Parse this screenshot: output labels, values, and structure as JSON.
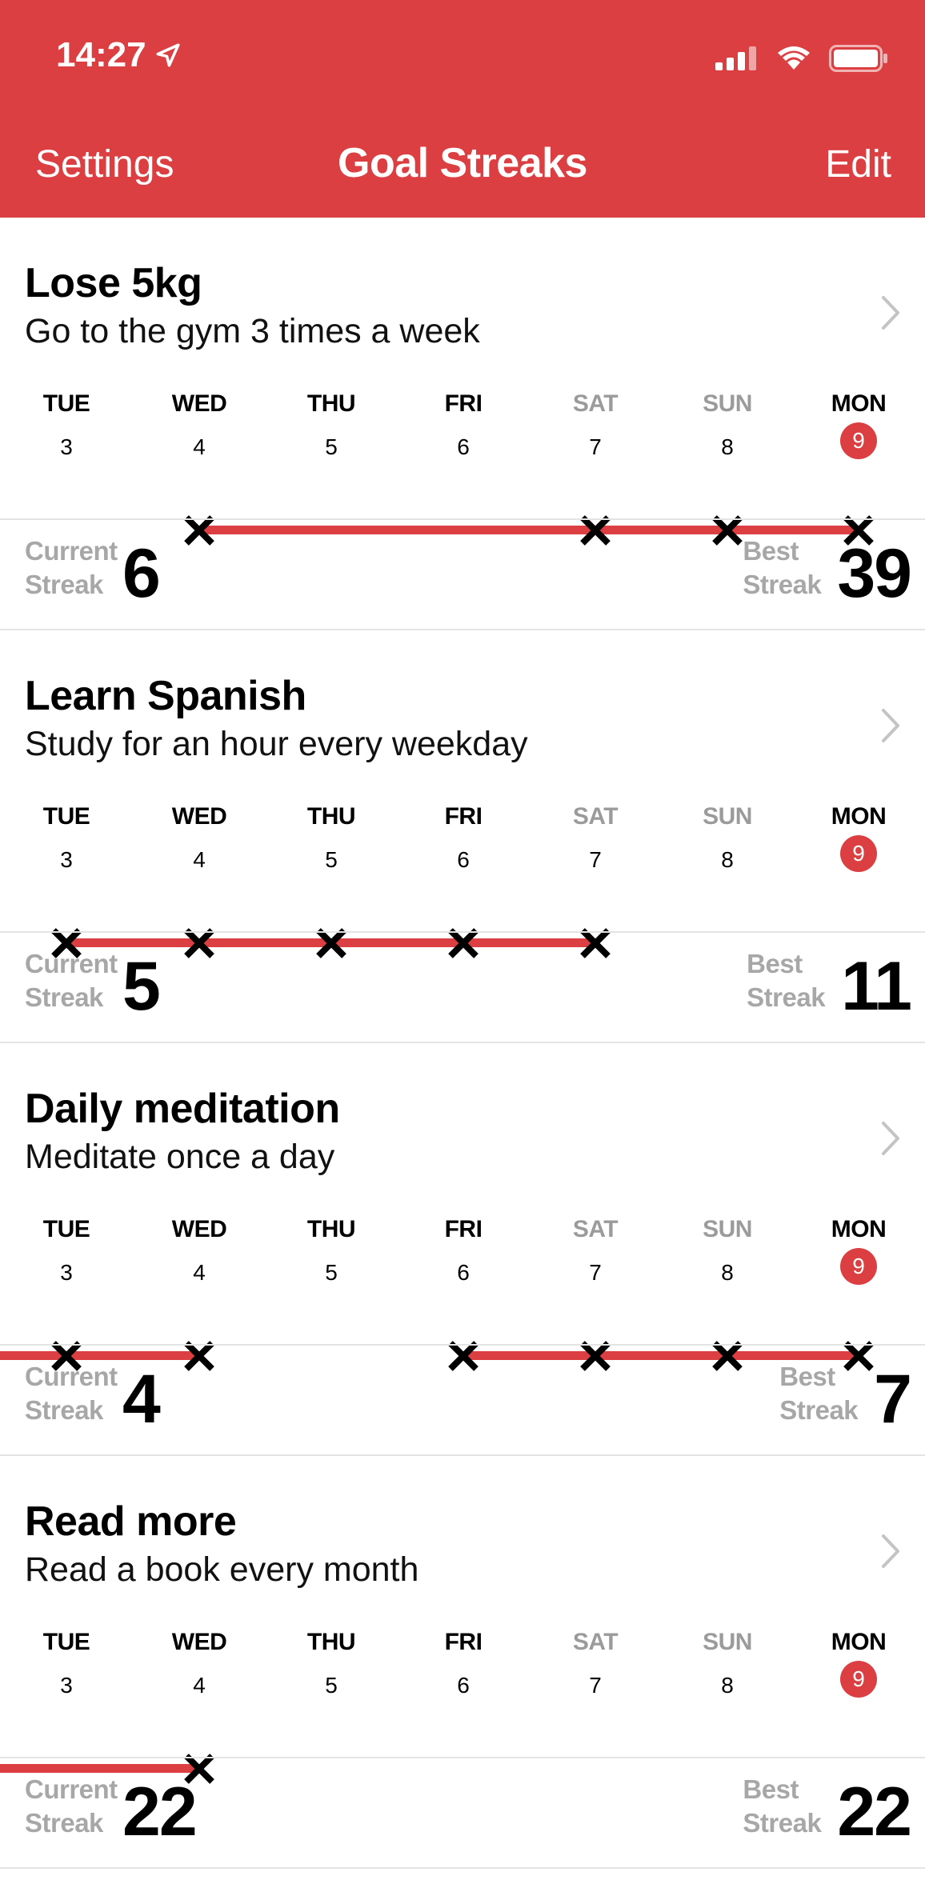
{
  "status_bar": {
    "time": "14:27",
    "location_icon": "location-arrow-icon",
    "signal_icon": "cellular-signal-icon",
    "wifi_icon": "wifi-icon",
    "battery_icon": "battery-icon"
  },
  "nav": {
    "left": "Settings",
    "title": "Goal Streaks",
    "right": "Edit"
  },
  "theme": {
    "accent": "#db3f41",
    "muted": "#a7a7a7"
  },
  "labels": {
    "current": [
      "Current",
      "Streak"
    ],
    "best": [
      "Best",
      "Streak"
    ]
  },
  "day_columns": [
    {
      "name": "TUE",
      "num": "3",
      "weekend": false,
      "today": false
    },
    {
      "name": "WED",
      "num": "4",
      "weekend": false,
      "today": false
    },
    {
      "name": "THU",
      "num": "5",
      "weekend": false,
      "today": false
    },
    {
      "name": "FRI",
      "num": "6",
      "weekend": false,
      "today": false
    },
    {
      "name": "SAT",
      "num": "7",
      "weekend": true,
      "today": false
    },
    {
      "name": "SUN",
      "num": "8",
      "weekend": true,
      "today": false
    },
    {
      "name": "MON",
      "num": "9",
      "weekend": false,
      "today": true
    }
  ],
  "goals": [
    {
      "title": "Lose 5kg",
      "subtitle": "Go to the gym 3 times a week",
      "completed": [
        false,
        true,
        false,
        false,
        true,
        true,
        true
      ],
      "streak_from": 1,
      "streak_to": 6,
      "streak_continues_left": false,
      "current_streak": "6",
      "best_streak": "39"
    },
    {
      "title": "Learn Spanish",
      "subtitle": "Study for an hour every weekday",
      "completed": [
        true,
        true,
        true,
        true,
        true,
        false,
        false
      ],
      "streak_from": 0,
      "streak_to": 4,
      "streak_continues_left": false,
      "current_streak": "5",
      "best_streak": "11"
    },
    {
      "title": "Daily meditation",
      "subtitle": "Meditate once a day",
      "completed": [
        true,
        true,
        false,
        true,
        true,
        true,
        true
      ],
      "streak_from": 3,
      "streak_to": 6,
      "streak_continues_left": true,
      "left_segment_to": 1,
      "current_streak": "4",
      "best_streak": "7"
    },
    {
      "title": "Read more",
      "subtitle": "Read a book every month",
      "completed": [
        false,
        true,
        false,
        false,
        false,
        false,
        false
      ],
      "streak_from": 1,
      "streak_to": 1,
      "streak_continues_left": true,
      "left_segment_to": 1,
      "current_streak": "22",
      "best_streak": "22"
    }
  ]
}
